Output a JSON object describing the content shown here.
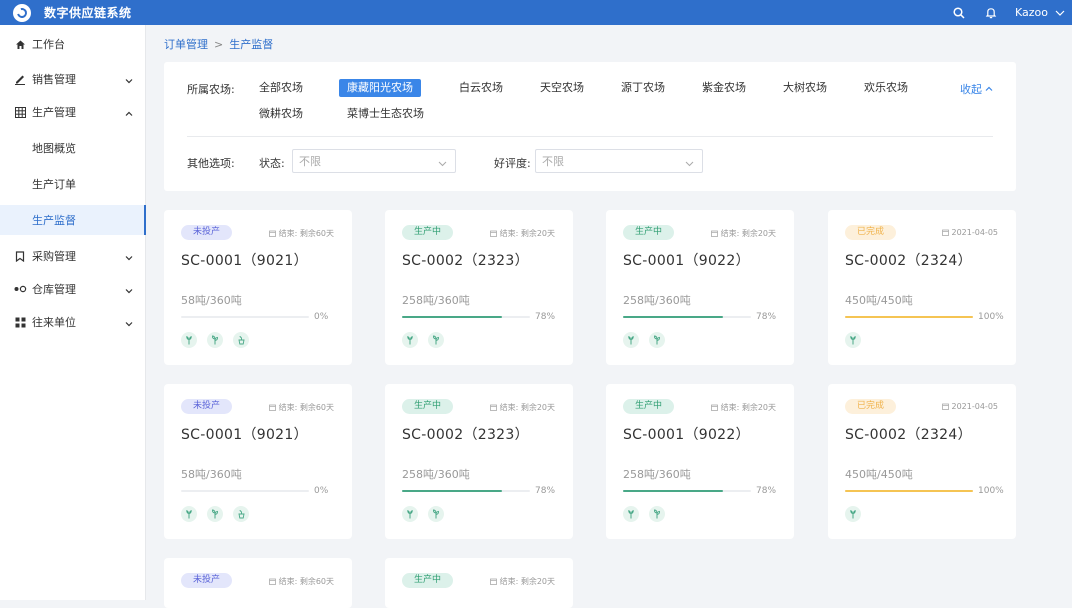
{
  "app": {
    "title": "数字供应链系统",
    "user": "Kazoo"
  },
  "topbar": {
    "icons": [
      "search-icon",
      "bell-icon",
      "chevron-down-icon"
    ]
  },
  "sidebar": {
    "items": [
      {
        "label": "工作台",
        "icon": "home-icon"
      },
      {
        "label": "销售管理",
        "icon": "pen-icon",
        "expanded": false
      },
      {
        "label": "生产管理",
        "icon": "grid-icon",
        "expanded": true,
        "children": [
          {
            "label": "地图概览"
          },
          {
            "label": "生产订单"
          },
          {
            "label": "生产监督",
            "active": true
          }
        ]
      },
      {
        "label": "采购管理",
        "icon": "bookmark-icon",
        "expanded": false
      },
      {
        "label": "仓库管理",
        "icon": "warehouse-icon",
        "expanded": false
      },
      {
        "label": "往来单位",
        "icon": "apps-icon",
        "expanded": false
      }
    ]
  },
  "breadcrumb": {
    "parent": "订单管理",
    "separator": ">",
    "current": "生产监督"
  },
  "filters": {
    "farm_label": "所属农场:",
    "farms": [
      "全部农场",
      "康藏阳光农场",
      "白云农场",
      "天空农场",
      "源丁农场",
      "紫金农场",
      "大树农场",
      "欢乐农场",
      "微耕农场",
      "菜博士生态农场"
    ],
    "active_farm": "康藏阳光农场",
    "collapse_label": "收起",
    "other_label": "其他选项:",
    "status_label": "状态:",
    "status_value": "不限",
    "rating_label": "好评度:",
    "rating_value": "不限"
  },
  "status_colors": {
    "todo": "#5b64d8",
    "prog": "#2f9e72",
    "done": "#f0b24a",
    "accent": "#2f6fcb"
  },
  "cards": [
    {
      "status": "未投产",
      "kind": "todo",
      "date": "结束: 剩余60天",
      "title": "SC-0001（9021）",
      "weight": "58吨/360吨",
      "progress": 0,
      "percent": "0%",
      "tools": [
        "seedling-icon",
        "sprout-icon",
        "pot-icon"
      ]
    },
    {
      "status": "生产中",
      "kind": "prog",
      "date": "结束: 剩余20天",
      "title": "SC-0002（2323）",
      "weight": "258吨/360吨",
      "progress": 78,
      "percent": "78%",
      "tools": [
        "seedling-icon",
        "sprout-icon"
      ]
    },
    {
      "status": "生产中",
      "kind": "prog",
      "date": "结束: 剩余20天",
      "title": "SC-0001（9022）",
      "weight": "258吨/360吨",
      "progress": 78,
      "percent": "78%",
      "tools": [
        "seedling-icon",
        "sprout-icon"
      ]
    },
    {
      "status": "已完成",
      "kind": "done",
      "date": "2021-04-05",
      "title": "SC-0002（2324）",
      "weight": "450吨/450吨",
      "progress": 100,
      "percent": "100%",
      "tools": [
        "seedling-icon"
      ]
    },
    {
      "status": "未投产",
      "kind": "todo",
      "date": "结束: 剩余60天",
      "title": "SC-0001（9021）",
      "weight": "58吨/360吨",
      "progress": 0,
      "percent": "0%",
      "tools": [
        "seedling-icon",
        "sprout-icon",
        "pot-icon"
      ]
    },
    {
      "status": "生产中",
      "kind": "prog",
      "date": "结束: 剩余20天",
      "title": "SC-0002（2323）",
      "weight": "258吨/360吨",
      "progress": 78,
      "percent": "78%",
      "tools": [
        "seedling-icon",
        "sprout-icon"
      ]
    },
    {
      "status": "生产中",
      "kind": "prog",
      "date": "结束: 剩余20天",
      "title": "SC-0001（9022）",
      "weight": "258吨/360吨",
      "progress": 78,
      "percent": "78%",
      "tools": [
        "seedling-icon",
        "sprout-icon"
      ]
    },
    {
      "status": "已完成",
      "kind": "done",
      "date": "2021-04-05",
      "title": "SC-0002（2324）",
      "weight": "450吨/450吨",
      "progress": 100,
      "percent": "100%",
      "tools": [
        "seedling-icon"
      ]
    },
    {
      "status": "未投产",
      "kind": "todo",
      "date": "结束: 剩余60天"
    },
    {
      "status": "生产中",
      "kind": "prog",
      "date": "结束: 剩余20天"
    }
  ]
}
